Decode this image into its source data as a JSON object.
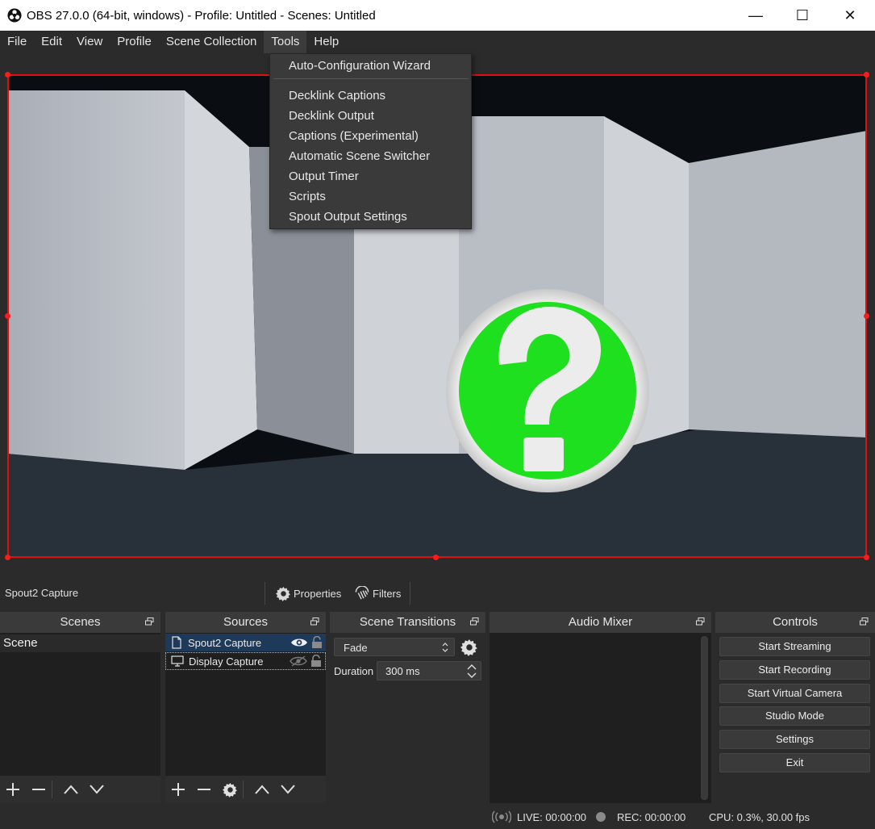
{
  "window": {
    "title": "OBS 27.0.0 (64-bit, windows) - Profile: Untitled - Scenes: Untitled",
    "minimize_glyph": "—",
    "maximize_glyph": "☐",
    "close_glyph": "✕"
  },
  "menubar": {
    "items": [
      {
        "label": "File"
      },
      {
        "label": "Edit"
      },
      {
        "label": "View"
      },
      {
        "label": "Profile"
      },
      {
        "label": "Scene Collection"
      },
      {
        "label": "Tools"
      },
      {
        "label": "Help"
      }
    ]
  },
  "tools_menu": {
    "items": [
      {
        "label": "Auto-Configuration Wizard"
      },
      {
        "label": "Decklink Captions"
      },
      {
        "label": "Decklink Output"
      },
      {
        "label": "Captions (Experimental)"
      },
      {
        "label": "Automatic Scene Switcher"
      },
      {
        "label": "Output Timer"
      },
      {
        "label": "Scripts"
      },
      {
        "label": "Spout Output Settings"
      }
    ]
  },
  "context_bar": {
    "selected_source": "Spout2 Capture",
    "properties_label": "Properties",
    "filters_label": "Filters"
  },
  "docks": {
    "scenes": {
      "title": "Scenes",
      "items": [
        {
          "label": "Scene"
        }
      ]
    },
    "sources": {
      "title": "Sources",
      "items": [
        {
          "label": "Spout2 Capture",
          "icon": "file-icon",
          "visible": true
        },
        {
          "label": "Display Capture",
          "icon": "monitor-icon",
          "visible": false
        }
      ]
    },
    "transitions": {
      "title": "Scene Transitions",
      "selected": "Fade",
      "duration_label": "Duration",
      "duration_value": "300 ms"
    },
    "mixer": {
      "title": "Audio Mixer"
    },
    "controls": {
      "title": "Controls",
      "buttons": [
        {
          "label": "Start Streaming"
        },
        {
          "label": "Start Recording"
        },
        {
          "label": "Start Virtual Camera"
        },
        {
          "label": "Studio Mode"
        },
        {
          "label": "Settings"
        },
        {
          "label": "Exit"
        }
      ]
    }
  },
  "status": {
    "live": "LIVE: 00:00:00",
    "rec": "REC: 00:00:00",
    "cpu": "CPU: 0.3%, 30.00 fps"
  },
  "colors": {
    "selection_border": "#e01010",
    "accent_green": "#1fe01f",
    "selected_row": "#1e3a5a"
  }
}
